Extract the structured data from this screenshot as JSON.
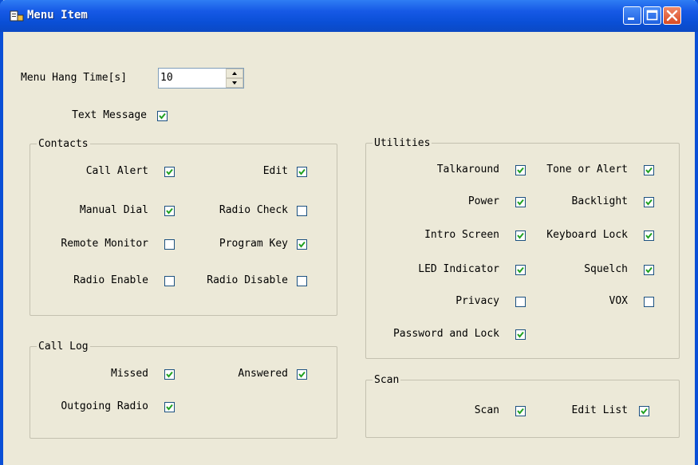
{
  "window": {
    "title": "Menu Item"
  },
  "menu_hang_time": {
    "label": "Menu Hang Time[s]",
    "value": "10"
  },
  "text_message": {
    "label": "Text Message",
    "checked": true
  },
  "contacts": {
    "title": "Contacts",
    "call_alert": {
      "label": "Call Alert",
      "checked": true
    },
    "edit": {
      "label": "Edit",
      "checked": true
    },
    "manual_dial": {
      "label": "Manual Dial",
      "checked": true
    },
    "radio_check": {
      "label": "Radio Check",
      "checked": false
    },
    "remote_monitor": {
      "label": "Remote Monitor",
      "checked": false
    },
    "program_key": {
      "label": "Program Key",
      "checked": true
    },
    "radio_enable": {
      "label": "Radio Enable",
      "checked": false
    },
    "radio_disable": {
      "label": "Radio Disable",
      "checked": false
    }
  },
  "call_log": {
    "title": "Call Log",
    "missed": {
      "label": "Missed",
      "checked": true
    },
    "answered": {
      "label": "Answered",
      "checked": true
    },
    "outgoing_radio": {
      "label": "Outgoing Radio",
      "checked": true
    }
  },
  "utilities": {
    "title": "Utilities",
    "talkaround": {
      "label": "Talkaround",
      "checked": true
    },
    "tone_or_alert": {
      "label": "Tone or Alert",
      "checked": true
    },
    "power": {
      "label": "Power",
      "checked": true
    },
    "backlight": {
      "label": "Backlight",
      "checked": true
    },
    "intro_screen": {
      "label": "Intro Screen",
      "checked": true
    },
    "keyboard_lock": {
      "label": "Keyboard Lock",
      "checked": true
    },
    "led_indicator": {
      "label": "LED Indicator",
      "checked": true
    },
    "squelch": {
      "label": "Squelch",
      "checked": true
    },
    "privacy": {
      "label": "Privacy",
      "checked": false
    },
    "vox": {
      "label": "VOX",
      "checked": false
    },
    "password_and_lock": {
      "label": "Password and Lock",
      "checked": true
    }
  },
  "scan": {
    "title": "Scan",
    "scan": {
      "label": "Scan",
      "checked": true
    },
    "edit_list": {
      "label": "Edit List",
      "checked": true
    }
  },
  "colors": {
    "title_bar": "#0a4fd6",
    "dialog_bg": "#ece9d8",
    "check_mark": "#21a121"
  },
  "icons": {
    "app": "menu-app-icon",
    "minimize": "minimize-icon",
    "maximize": "maximize-icon",
    "close": "close-icon",
    "check": "checkmark-icon",
    "spin_up": "arrow-up-icon",
    "spin_down": "arrow-down-icon"
  }
}
